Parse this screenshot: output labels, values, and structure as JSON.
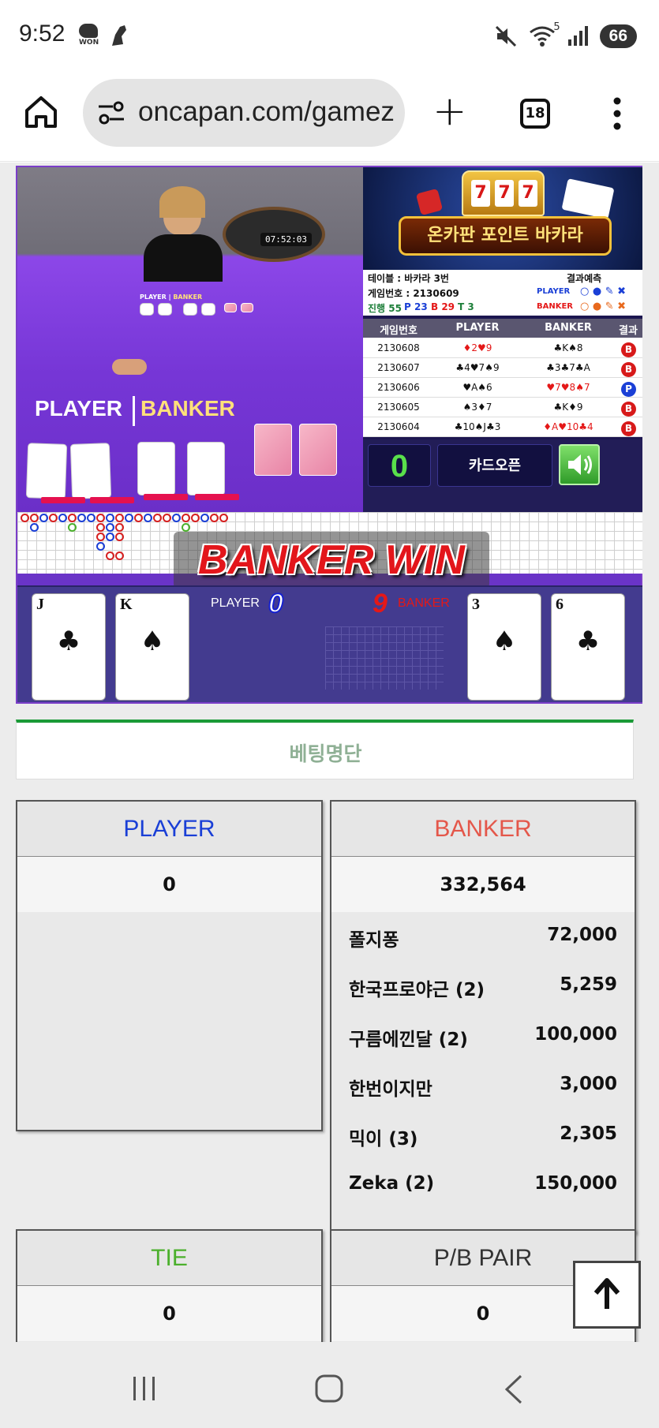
{
  "status_bar": {
    "time": "9:52",
    "won_badge": "WON",
    "battery": "66",
    "wifi_label": "5"
  },
  "browser": {
    "url": "oncapan.com/gamez",
    "tab_count": "18"
  },
  "game": {
    "video": {
      "timer": "07:52:03",
      "player_label": "PLAYER",
      "banker_label": "BANKER",
      "small_player_label": "PLAYER",
      "small_banker_label": "BANKER"
    },
    "banner_title": "온카판 포인트 바카라",
    "slot_digits": [
      "7",
      "7",
      "7"
    ],
    "info": {
      "table": "테이블 : 바카라 3번",
      "prediction_label": "결과예측",
      "game_no": "게임번호 : 2130609",
      "player_label": "PLAYER",
      "banker_label": "BANKER",
      "progress_label": "진행 55",
      "p_count": "P 23",
      "b_count": "B 29",
      "t_count": "T 3"
    },
    "history": {
      "headers": [
        "게임번호",
        "PLAYER",
        "BANKER",
        "결과"
      ],
      "rows": [
        {
          "no": "2130608",
          "player": "♦2♥9",
          "banker": "♣K♠8",
          "result": "B"
        },
        {
          "no": "2130607",
          "player": "♣4♥7♠9",
          "banker": "♣3♣7♣A",
          "result": "B"
        },
        {
          "no": "2130606",
          "player": "♥A♠6",
          "banker": "♥7♥8♠7",
          "result": "P"
        },
        {
          "no": "2130605",
          "player": "♠3♦7",
          "banker": "♣K♦9",
          "result": "B"
        },
        {
          "no": "2130604",
          "player": "♣10♠J♣3",
          "banker": "♦A♥10♣4",
          "result": "B"
        }
      ]
    },
    "counter": "0",
    "card_open_label": "카드오픈",
    "result_text": "BANKER WIN",
    "player_score_label": "PLAYER",
    "player_score": "0",
    "banker_score": "9",
    "banker_score_label": "BANKER",
    "player_cards": [
      {
        "rank": "J",
        "suit": "♣"
      },
      {
        "rank": "K",
        "suit": "♠"
      }
    ],
    "banker_cards": [
      {
        "rank": "3",
        "suit": "♠"
      },
      {
        "rank": "6",
        "suit": "♣"
      }
    ]
  },
  "betting": {
    "title": "베팅명단",
    "player": {
      "label": "PLAYER",
      "total": "0",
      "color": "#1a3fd6"
    },
    "banker": {
      "label": "BANKER",
      "total": "332,564",
      "color": "#e4574a",
      "entries": [
        {
          "name": "폴지퐁",
          "amount": "72,000"
        },
        {
          "name": "한국프로야근 (2)",
          "amount": "5,259"
        },
        {
          "name": "구름에낀달 (2)",
          "amount": "100,000"
        },
        {
          "name": "한번이지만",
          "amount": "3,000"
        },
        {
          "name": "믹이 (3)",
          "amount": "2,305"
        },
        {
          "name": "Zeka (2)",
          "amount": "150,000"
        }
      ]
    },
    "tie": {
      "label": "TIE",
      "total": "0",
      "color": "#4bb02c"
    },
    "pair": {
      "label": "P/B PAIR",
      "total": "0",
      "color": "#333333"
    }
  },
  "colors": {
    "player_blue": "#1a3fd6",
    "banker_red": "#e4574a",
    "tie_green": "#4bb02c"
  },
  "icons": [
    "home-icon",
    "tune-icon",
    "plus-icon",
    "tabs-icon",
    "menu-icon",
    "speaker-icon",
    "arrow-up-icon",
    "recents-icon",
    "home-nav-icon",
    "back-icon"
  ]
}
